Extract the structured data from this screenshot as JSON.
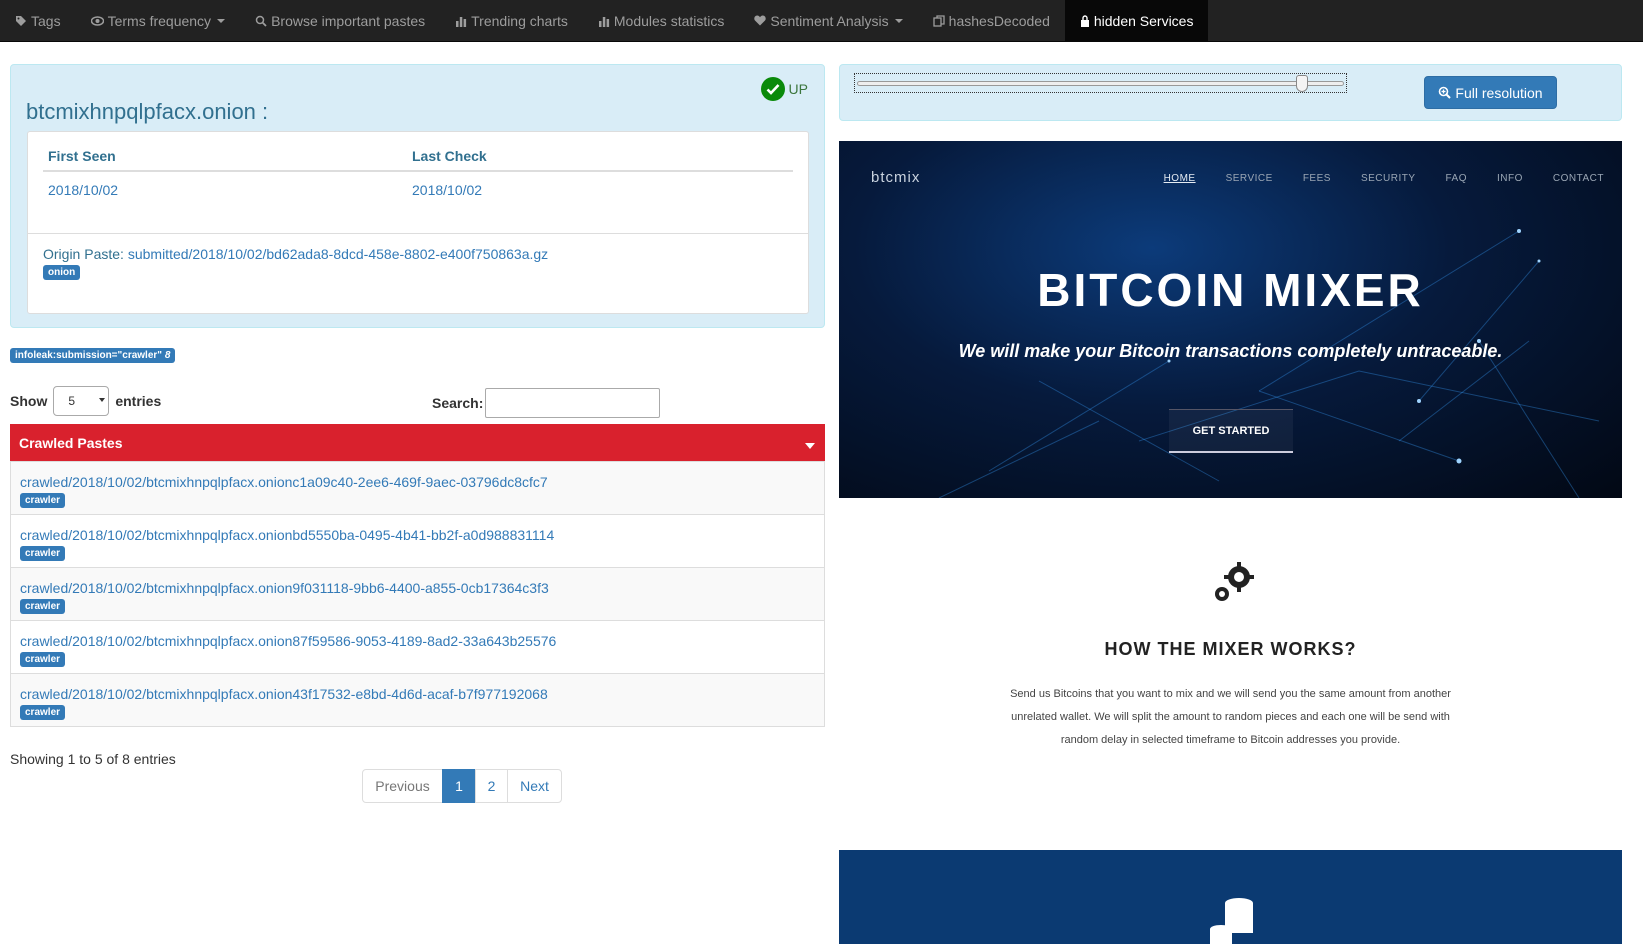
{
  "nav": {
    "items": [
      {
        "label": "Tags",
        "icon": "tag-icon"
      },
      {
        "label": "Terms frequency",
        "icon": "eye-icon",
        "dropdown": true
      },
      {
        "label": "Browse important pastes",
        "icon": "search-icon"
      },
      {
        "label": "Trending charts",
        "icon": "bar-chart-icon"
      },
      {
        "label": "Modules statistics",
        "icon": "bar-chart-icon"
      },
      {
        "label": "Sentiment Analysis",
        "icon": "heart-icon",
        "dropdown": true
      },
      {
        "label": "hashesDecoded",
        "icon": "copy-icon"
      },
      {
        "label": "hidden Services",
        "icon": "lock-icon",
        "active": true
      }
    ]
  },
  "domain": {
    "name": "btcmixhnpqlpfacx.onion :",
    "status": "UP",
    "first_seen_header": "First Seen",
    "last_check_header": "Last Check",
    "first_seen": "2018/10/02",
    "last_check": "2018/10/02",
    "origin_label": "Origin Paste:",
    "origin_paste": "submitted/2018/10/02/bd62ada8-8dcd-458e-8802-e400f750863a.gz",
    "origin_tag": "onion",
    "tag": "infoleak:submission=\"crawler\"",
    "tag_count": "8"
  },
  "table": {
    "show_label": "Show",
    "entries_value": "5",
    "entries_label": "entries",
    "search_label": "Search:",
    "search_value": "",
    "header": "Crawled Pastes",
    "rows": [
      {
        "path": "crawled/2018/10/02/btcmixhnpqlpfacx.onionc1a09c40-2ee6-469f-9aec-03796dc8cfc7",
        "tag": "crawler"
      },
      {
        "path": "crawled/2018/10/02/btcmixhnpqlpfacx.onionbd5550ba-0495-4b41-bb2f-a0d988831114",
        "tag": "crawler"
      },
      {
        "path": "crawled/2018/10/02/btcmixhnpqlpfacx.onion9f031118-9bb6-4400-a855-0cb17364c3f3",
        "tag": "crawler"
      },
      {
        "path": "crawled/2018/10/02/btcmixhnpqlpfacx.onion87f59586-9053-4189-8ad2-33a643b25576",
        "tag": "crawler"
      },
      {
        "path": "crawled/2018/10/02/btcmixhnpqlpfacx.onion43f17532-e8bd-4d6d-acaf-b7f977192068",
        "tag": "crawler"
      }
    ],
    "showing": "Showing 1 to 5 of 8 entries",
    "pagination": {
      "previous": "Previous",
      "page1": "1",
      "page2": "2",
      "next": "Next",
      "current_page": 1
    }
  },
  "screenshot_panel": {
    "slider_level": 0.92,
    "full_resolution_label": "Full resolution",
    "site": {
      "logo": "btcmix",
      "nav": [
        "HOME",
        "SERVICE",
        "FEES",
        "SECURITY",
        "FAQ",
        "INFO",
        "CONTACT"
      ],
      "title": "BITCOIN MIXER",
      "subtitle": "We will make your Bitcoin transactions completely untraceable.",
      "cta": "GET STARTED",
      "how_title": "HOW THE MIXER WORKS?",
      "how_text": "Send us Bitcoins that you want to mix and we will send you the same amount from another unrelated wallet. We will split the amount to random pieces and each one will be send with random delay in selected timeframe to Bitcoin addresses you provide."
    }
  },
  "colors": {
    "navbar": "#222222",
    "accent": "#337ab7",
    "table_header": "#d9212d",
    "info_bg": "#d9edf7",
    "status_up": "#0a8a0a"
  }
}
